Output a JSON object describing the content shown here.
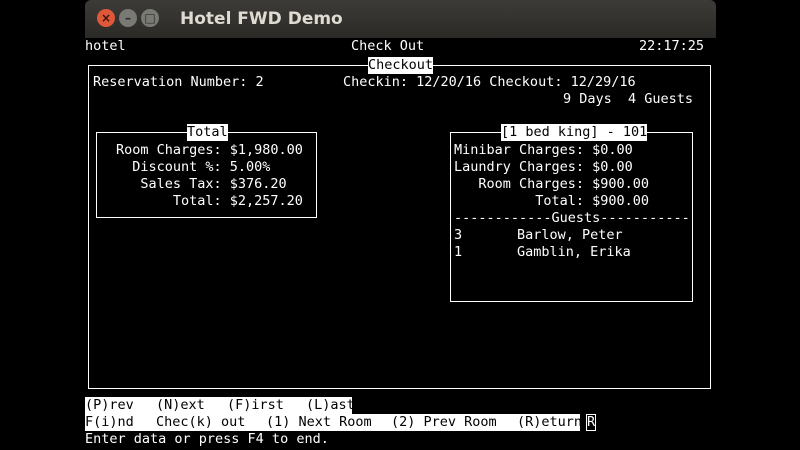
{
  "window": {
    "title": "Hotel FWD Demo"
  },
  "header": {
    "app": "hotel",
    "screen": "Check Out",
    "time": "22:17:25"
  },
  "checkout": {
    "frame_title": "Checkout",
    "reservation": "Reservation Number: 2",
    "dates": "Checkin: 12/20/16 Checkout: 12/29/16",
    "stay": "9 Days  4 Guests"
  },
  "total": {
    "title": "Total",
    "lines": [
      "Room Charges: $1,980.00",
      "  Discount %: 5.00%",
      "   Sales Tax: $376.20",
      "       Total: $2,257.20"
    ]
  },
  "room": {
    "title": "[1 bed king] - 101",
    "lines": [
      "Minibar Charges: $0.00",
      "Laundry Charges: $0.00",
      "   Room Charges: $900.00",
      "          Total: $900.00"
    ],
    "guests_rule": "------------Guests-----------",
    "guests": [
      {
        "num": "3",
        "name": "Barlow, Peter"
      },
      {
        "num": "1",
        "name": "Gamblin, Erika"
      }
    ]
  },
  "footer": {
    "menu1": [
      "(P)rev",
      "(N)ext",
      "(F)irst",
      "(L)ast"
    ],
    "menu2": [
      "F(i)nd",
      "Chec(k) out",
      "(1) Next Room",
      "(2) Prev Room",
      "(R)eturn"
    ],
    "cursor_char": "R",
    "status": "Enter data or press F4 to end."
  }
}
